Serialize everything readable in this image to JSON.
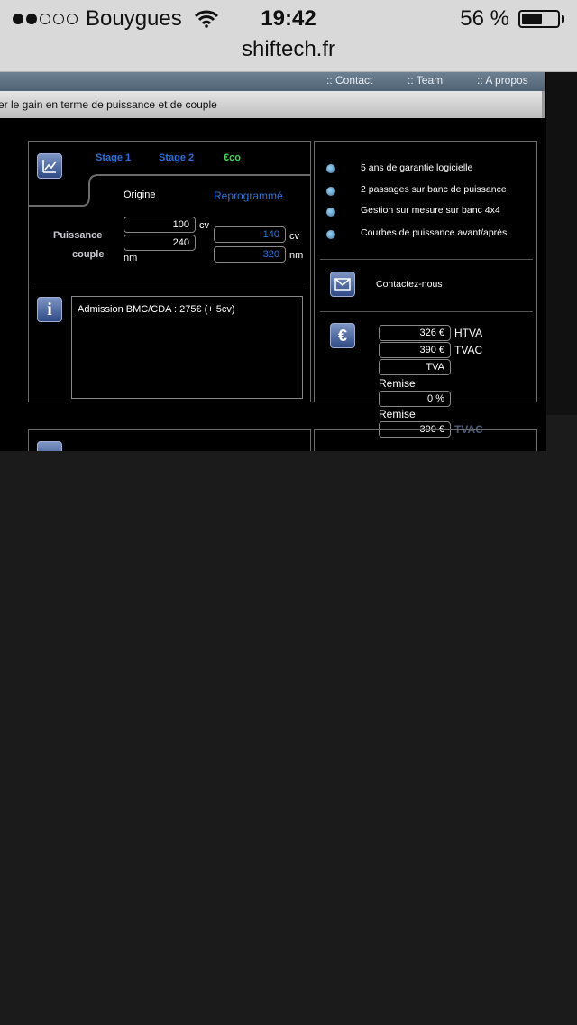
{
  "status_bar": {
    "carrier": "Bouygues",
    "time": "19:42",
    "battery": "56 %"
  },
  "browser": {
    "url": "shiftech.fr"
  },
  "nav": {
    "contact": ":: Contact",
    "team": ":: Team",
    "about": ":: A propos"
  },
  "subtitle": "er le gain en terme de puissance et de couple",
  "tabs": {
    "stage1": "Stage 1",
    "stage2": "Stage 2",
    "eco": "€co"
  },
  "perf": {
    "origin_label": "Origine",
    "reprog_label": "Reprogrammé",
    "power_label": "Puissance",
    "torque_label": "couple",
    "origin_power": "100",
    "origin_torque": "240",
    "reprog_power": "140",
    "reprog_torque": "320",
    "unit_cv": "cv",
    "unit_nm": "nm"
  },
  "info_text": "Admission BMC/CDA : 275€ (+ 5cv)",
  "features": [
    "5 ans de garantie logicielle",
    "2 passages sur banc de puissance",
    "Gestion sur mesure sur banc 4x4",
    "Courbes de puissance avant/après"
  ],
  "contact_label": "Contactez-nous",
  "pricing": {
    "htva_value": "326 €",
    "htva_label": "HTVA",
    "tvac_value": "390 €",
    "tvac_label": "TVAC",
    "tva_value": "TVA",
    "remise_label": "Remise",
    "remise_value": "0 %",
    "remise_label2": "Remise",
    "final_value": "390 €",
    "final_label": "TVAC"
  },
  "colors": {
    "tab_blue": "#2a6fd6",
    "eco_green": "#38d94a",
    "reprog_blue": "#2c73d8",
    "panel_border": "#6b6b6b"
  }
}
